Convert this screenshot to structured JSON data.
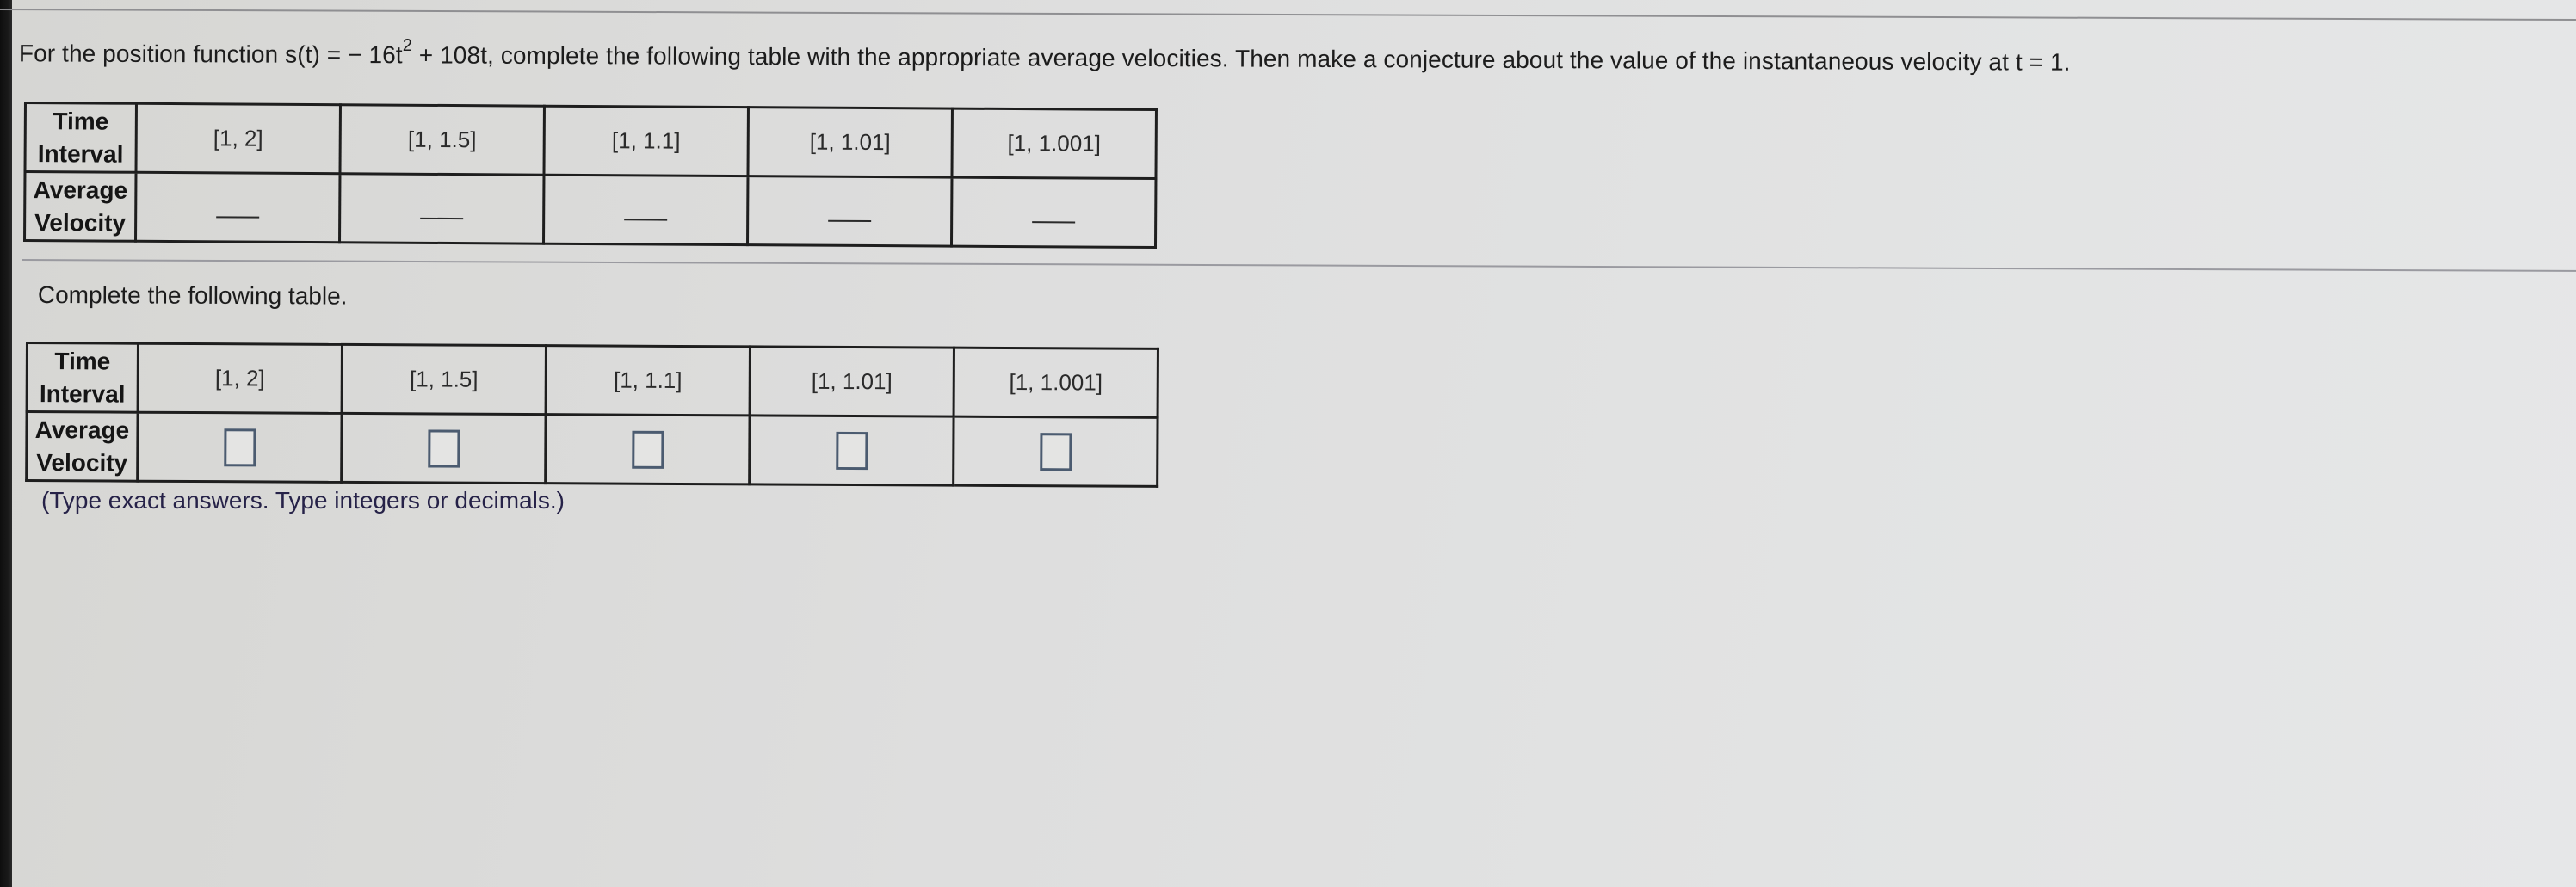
{
  "question": {
    "prefix": "For the position function s(t) = − 16t",
    "exponent": "2",
    "suffix": " + 108t, complete the following table with the appropriate average velocities. Then make a conjecture about the value of the instantaneous velocity at t = 1."
  },
  "reference_table": {
    "row_headers": {
      "time_interval": [
        "Time",
        "Interval"
      ],
      "average_velocity": [
        "Average",
        "Velocity"
      ]
    },
    "intervals": [
      "[1, 2]",
      "[1, 1.5]",
      "[1, 1.1]",
      "[1, 1.01]",
      "[1, 1.001]"
    ],
    "velocities": [
      "",
      "",
      "",
      "",
      ""
    ],
    "blank_placeholder": "____"
  },
  "prompt": "Complete the following table.",
  "answer_table": {
    "row_headers": {
      "time_interval": [
        "Time",
        "Interval"
      ],
      "average_velocity": [
        "Average",
        "Velocity"
      ]
    },
    "intervals": [
      "[1, 2]",
      "[1, 1.5]",
      "[1, 1.1]",
      "[1, 1.01]",
      "[1, 1.001]"
    ],
    "answers": [
      "",
      "",
      "",
      "",
      ""
    ]
  },
  "hint": "(Type exact answers. Type integers or decimals.)",
  "colors": {
    "answer_box_border": "#4b5b70",
    "hint_text": "#262248"
  }
}
